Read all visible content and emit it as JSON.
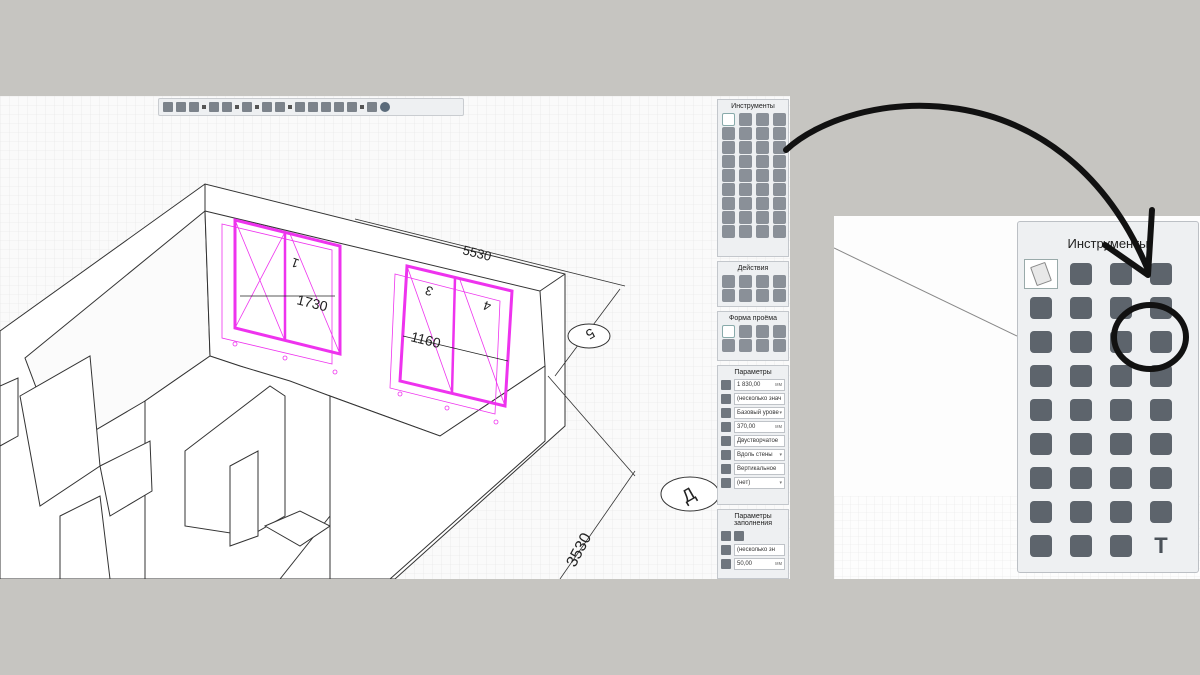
{
  "left": {
    "canvas": {
      "dimension_top": "5530",
      "dimension_right": "3530",
      "axis_number": "5",
      "axis_letter": "Д",
      "window1_width": "1730",
      "window2_width": "1160",
      "window1_sash_label": "1",
      "window2_sash_labels": [
        "3",
        "4"
      ]
    },
    "panels": {
      "tools_title": "Инструменты",
      "actions_title": "Действия",
      "opening_shape_title": "Форма проёма",
      "params_title": "Параметры",
      "fill_params_title": "Параметры заполнения"
    },
    "params": {
      "width_value": "1 830,00",
      "width_unit": "мм",
      "name_value": "(несколько знач",
      "base_level": "Базовый урове",
      "offset_value": "370,00",
      "offset_unit": "мм",
      "type_value": "Двустворчатое",
      "placement_value": "Вдоль стены",
      "orientation_value": "Вертикальное",
      "extra_value": "(нет)"
    },
    "fill_params": {
      "name_value": "(несколько зн",
      "thickness_value": "50,00",
      "thickness_unit": "мм"
    }
  },
  "right": {
    "panel_title": "Инструменты",
    "text_tool": "T"
  }
}
